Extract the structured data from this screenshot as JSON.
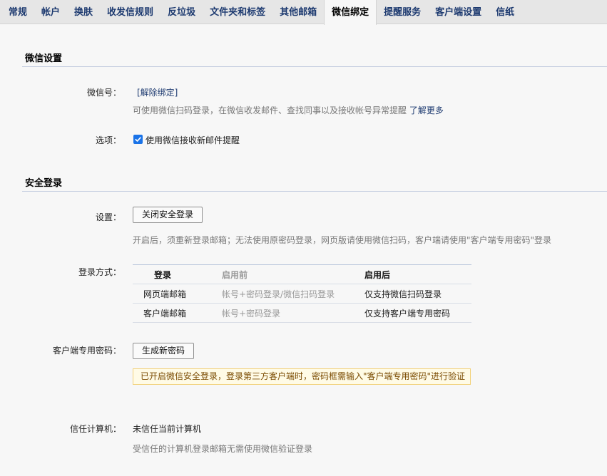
{
  "tabs": [
    {
      "label": "常规"
    },
    {
      "label": "帐户"
    },
    {
      "label": "换肤"
    },
    {
      "label": "收发信规则"
    },
    {
      "label": "反垃圾"
    },
    {
      "label": "文件夹和标签"
    },
    {
      "label": "其他邮箱"
    },
    {
      "label": "微信绑定",
      "active": true
    },
    {
      "label": "提醒服务"
    },
    {
      "label": "客户端设置"
    },
    {
      "label": "信纸"
    }
  ],
  "wechat": {
    "title": "微信设置",
    "account_label": "微信号：",
    "unbind_link": "[解除绑定]",
    "hint": "可使用微信扫码登录，在微信收发邮件、查找同事以及接收帐号异常提醒",
    "learn_more": "了解更多",
    "options_label": "选项：",
    "option_checked": true,
    "option_text": "使用微信接收新邮件提醒"
  },
  "security": {
    "title": "安全登录",
    "setting_label": "设置：",
    "close_button": "关闭安全登录",
    "setting_hint": "开启后，须重新登录邮箱；无法使用原密码登录，网页版请使用微信扫码，客户端请使用\"客户端专用密码\"登录",
    "method_label": "登录方式：",
    "table": {
      "headers": [
        "登录",
        "启用前",
        "启用后"
      ],
      "rows": [
        [
          "网页端邮箱",
          "帐号+密码登录/微信扫码登录",
          "仅支持微信扫码登录"
        ],
        [
          "客户端邮箱",
          "帐号+密码登录",
          "仅支持客户端专用密码"
        ]
      ]
    },
    "client_pwd_label": "客户端专用密码：",
    "generate_button": "生成新密码",
    "notice": "已开启微信安全登录，登录第三方客户端时，密码框需输入\"客户端专用密码\"进行验证",
    "trust_label": "信任计算机：",
    "trust_value": "未信任当前计算机",
    "trust_hint": "受信任的计算机登录邮箱无需使用微信验证登录"
  }
}
